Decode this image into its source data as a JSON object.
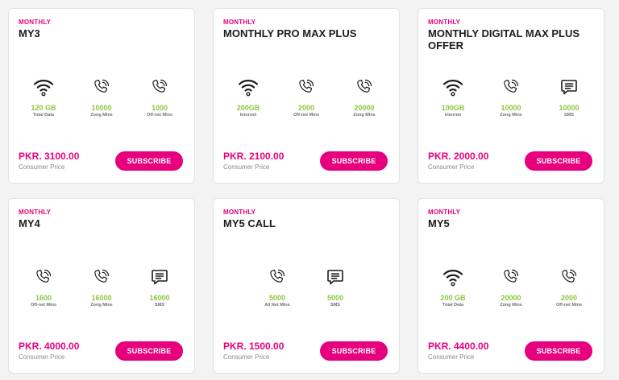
{
  "colors": {
    "accent": "#e6007e",
    "value": "#8cc63f",
    "text": "#1d1d1d",
    "muted": "#8a8a8a"
  },
  "packages": [
    {
      "cycle": "MONTHLY",
      "title": "MY3",
      "features": [
        {
          "icon": "wifi-icon",
          "value": "120 GB",
          "label": "Total Data"
        },
        {
          "icon": "phone-icon",
          "value": "10000",
          "label": "Zong Mins"
        },
        {
          "icon": "phone-icon",
          "value": "1000",
          "label": "Off-net Mins"
        }
      ],
      "price": "PKR. 3100.00",
      "price_label": "Consumer Price",
      "button_label": "SUBSCRIBE"
    },
    {
      "cycle": "MONTHLY",
      "title": "MONTHLY PRO MAX PLUS",
      "features": [
        {
          "icon": "wifi-icon",
          "value": "200GB",
          "label": "Internet"
        },
        {
          "icon": "phone-icon",
          "value": "2000",
          "label": "Off-net Mins"
        },
        {
          "icon": "phone-icon",
          "value": "20000",
          "label": "Zong Mins"
        }
      ],
      "price": "PKR. 2100.00",
      "price_label": "Consumer Price",
      "button_label": "SUBSCRIBE"
    },
    {
      "cycle": "MONTHLY",
      "title": "MONTHLY DIGITAL MAX PLUS OFFER",
      "features": [
        {
          "icon": "wifi-icon",
          "value": "100GB",
          "label": "Internet"
        },
        {
          "icon": "phone-icon",
          "value": "10000",
          "label": "Zong Mins"
        },
        {
          "icon": "sms-icon",
          "value": "10000",
          "label": "SMS"
        }
      ],
      "price": "PKR. 2000.00",
      "price_label": "Consumer Price",
      "button_label": "SUBSCRIBE"
    },
    {
      "cycle": "MONTHLY",
      "title": "MY4",
      "features": [
        {
          "icon": "phone-icon",
          "value": "1600",
          "label": "Off-net Mins"
        },
        {
          "icon": "phone-icon",
          "value": "16000",
          "label": "Zong Mins"
        },
        {
          "icon": "sms-icon",
          "value": "16000",
          "label": "SMS"
        }
      ],
      "price": "PKR. 4000.00",
      "price_label": "Consumer Price",
      "button_label": "SUBSCRIBE"
    },
    {
      "cycle": "MONTHLY",
      "title": "MY5 CALL",
      "features": [
        {
          "icon": "phone-icon",
          "value": "5000",
          "label": "All Net Mins"
        },
        {
          "icon": "sms-icon",
          "value": "5000",
          "label": "SMS"
        }
      ],
      "price": "PKR. 1500.00",
      "price_label": "Consumer Price",
      "button_label": "SUBSCRIBE"
    },
    {
      "cycle": "MONTHLY",
      "title": "MY5",
      "features": [
        {
          "icon": "wifi-icon",
          "value": "200 GB",
          "label": "Total Data"
        },
        {
          "icon": "phone-icon",
          "value": "20000",
          "label": "Zong Mins"
        },
        {
          "icon": "phone-icon",
          "value": "2000",
          "label": "Off-net Mins"
        }
      ],
      "price": "PKR. 4400.00",
      "price_label": "Consumer Price",
      "button_label": "SUBSCRIBE"
    }
  ]
}
